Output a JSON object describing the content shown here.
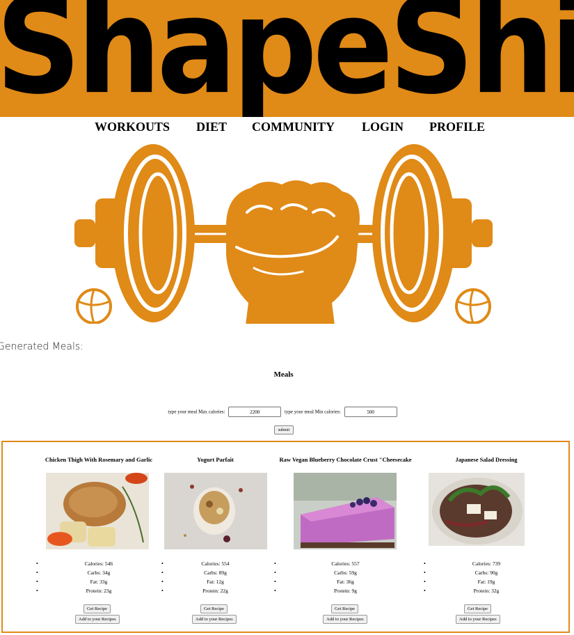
{
  "header": {
    "logo_text": "ShapeShift"
  },
  "nav": {
    "items": [
      "WORKOUTS",
      "DIET",
      "COMMUNITY",
      "LOGIN",
      "PROFILE"
    ]
  },
  "hero": {
    "accent_color": "#e08a17",
    "icon": "fist-dumbbell-icon"
  },
  "generated_label": "Generated Meals:",
  "meals_title": "Meals",
  "form": {
    "max_label": "type your meal Max calories:",
    "max_value": "2200",
    "min_label": "type your meal Min calories:",
    "min_value": "500",
    "submit_label": "submit"
  },
  "meals": [
    {
      "title": "Chicken Thigh With Rosemary and Garlic",
      "calories": "Calories: 546",
      "carbs": "Carbs: 34g",
      "fat": "Fat: 33g",
      "protein": "Protein: 23g",
      "get_recipe": "Get Recipe",
      "add_recipe": "Add to your Recipes"
    },
    {
      "title": "Yogurt Parfait",
      "calories": "Calories: 554",
      "carbs": "Carbs: 89g",
      "fat": "Fat: 12g",
      "protein": "Protein: 22g",
      "get_recipe": "Get Recipe",
      "add_recipe": "Add to your Recipes"
    },
    {
      "title": "Raw Vegan Blueberry Chocolate Crust \"Cheesecake",
      "calories": "Calories: 557",
      "carbs": "Carbs: 59g",
      "fat": "Fat: 36g",
      "protein": "Protein: 9g",
      "get_recipe": "Get Recipe",
      "add_recipe": "Add to your Recipes"
    },
    {
      "title": "Japanese Salad Dressing",
      "calories": "Calories: 739",
      "carbs": "Carbs: 90g",
      "fat": "Fat: 19g",
      "protein": "Protein: 32g",
      "get_recipe": "Get Recipe",
      "add_recipe": "Add to your Recipes"
    }
  ]
}
